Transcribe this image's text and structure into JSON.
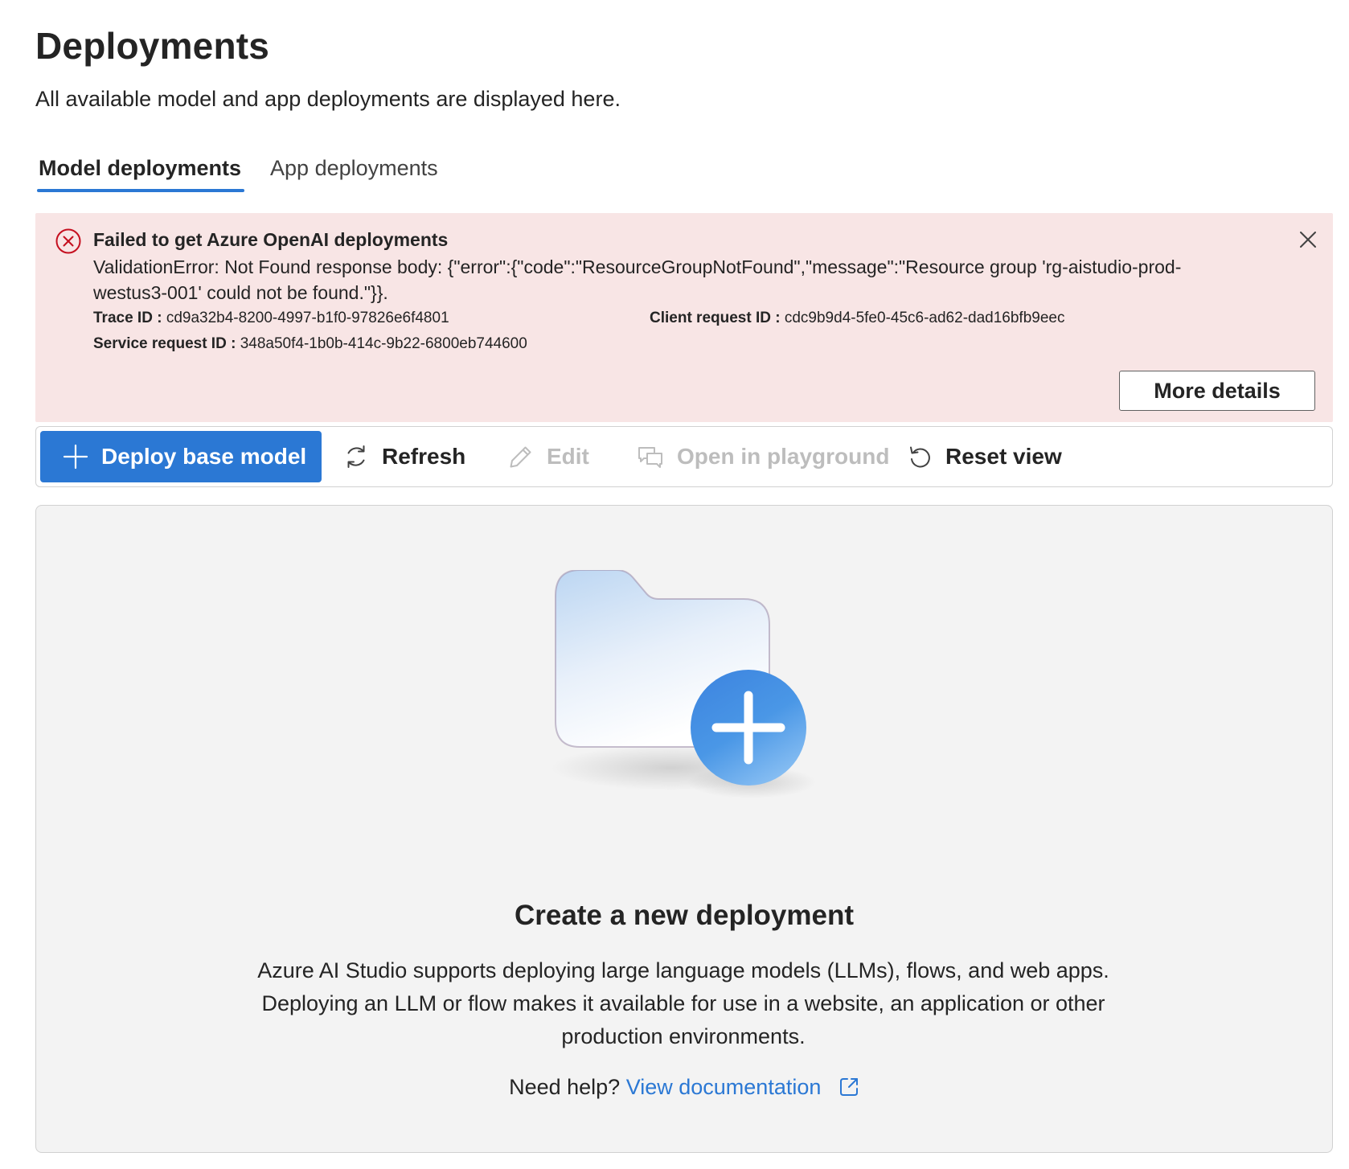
{
  "page": {
    "title": "Deployments",
    "subtitle": "All available model and app deployments are displayed here."
  },
  "tabs": [
    {
      "label": "Model deployments",
      "active": true
    },
    {
      "label": "App deployments",
      "active": false
    }
  ],
  "error": {
    "title": "Failed to get Azure OpenAI deployments",
    "message": "ValidationError: Not Found response body: {\"error\":{\"code\":\"ResourceGroupNotFound\",\"message\":\"Resource group 'rg-aistudio-prod-westus3-001' could not be found.\"}}.",
    "trace_id_label": "Trace ID :",
    "trace_id": "cd9a32b4-8200-4997-b1f0-97826e6f4801",
    "client_request_id_label": "Client request ID :",
    "client_request_id": "cdc9b9d4-5fe0-45c6-ad62-dad16bfb9eec",
    "service_request_id_label": "Service request ID :",
    "service_request_id": "348a50f4-1b0b-414c-9b22-6800eb744600",
    "more_details_label": "More details",
    "icon": "error-circle-icon",
    "close_icon": "dismiss-icon",
    "background_color": "#f8e5e5",
    "icon_color": "#c50f1f"
  },
  "toolbar": {
    "deploy_label": "Deploy base model",
    "refresh_label": "Refresh",
    "edit_label": "Edit",
    "playground_label": "Open in playground",
    "reset_label": "Reset view",
    "primary_color": "#2b78d4",
    "disabled_color": "#bdbdbd"
  },
  "empty_state": {
    "title": "Create a new deployment",
    "description": "Azure AI Studio supports deploying large language models (LLMs), flows, and web apps. Deploying an LLM or flow makes it available for use in a website, an application or other production environments.",
    "help_prefix": "Need help?",
    "link_label": "View documentation",
    "illustration": "folder-add-illustration",
    "link_color": "#2b78d4"
  }
}
